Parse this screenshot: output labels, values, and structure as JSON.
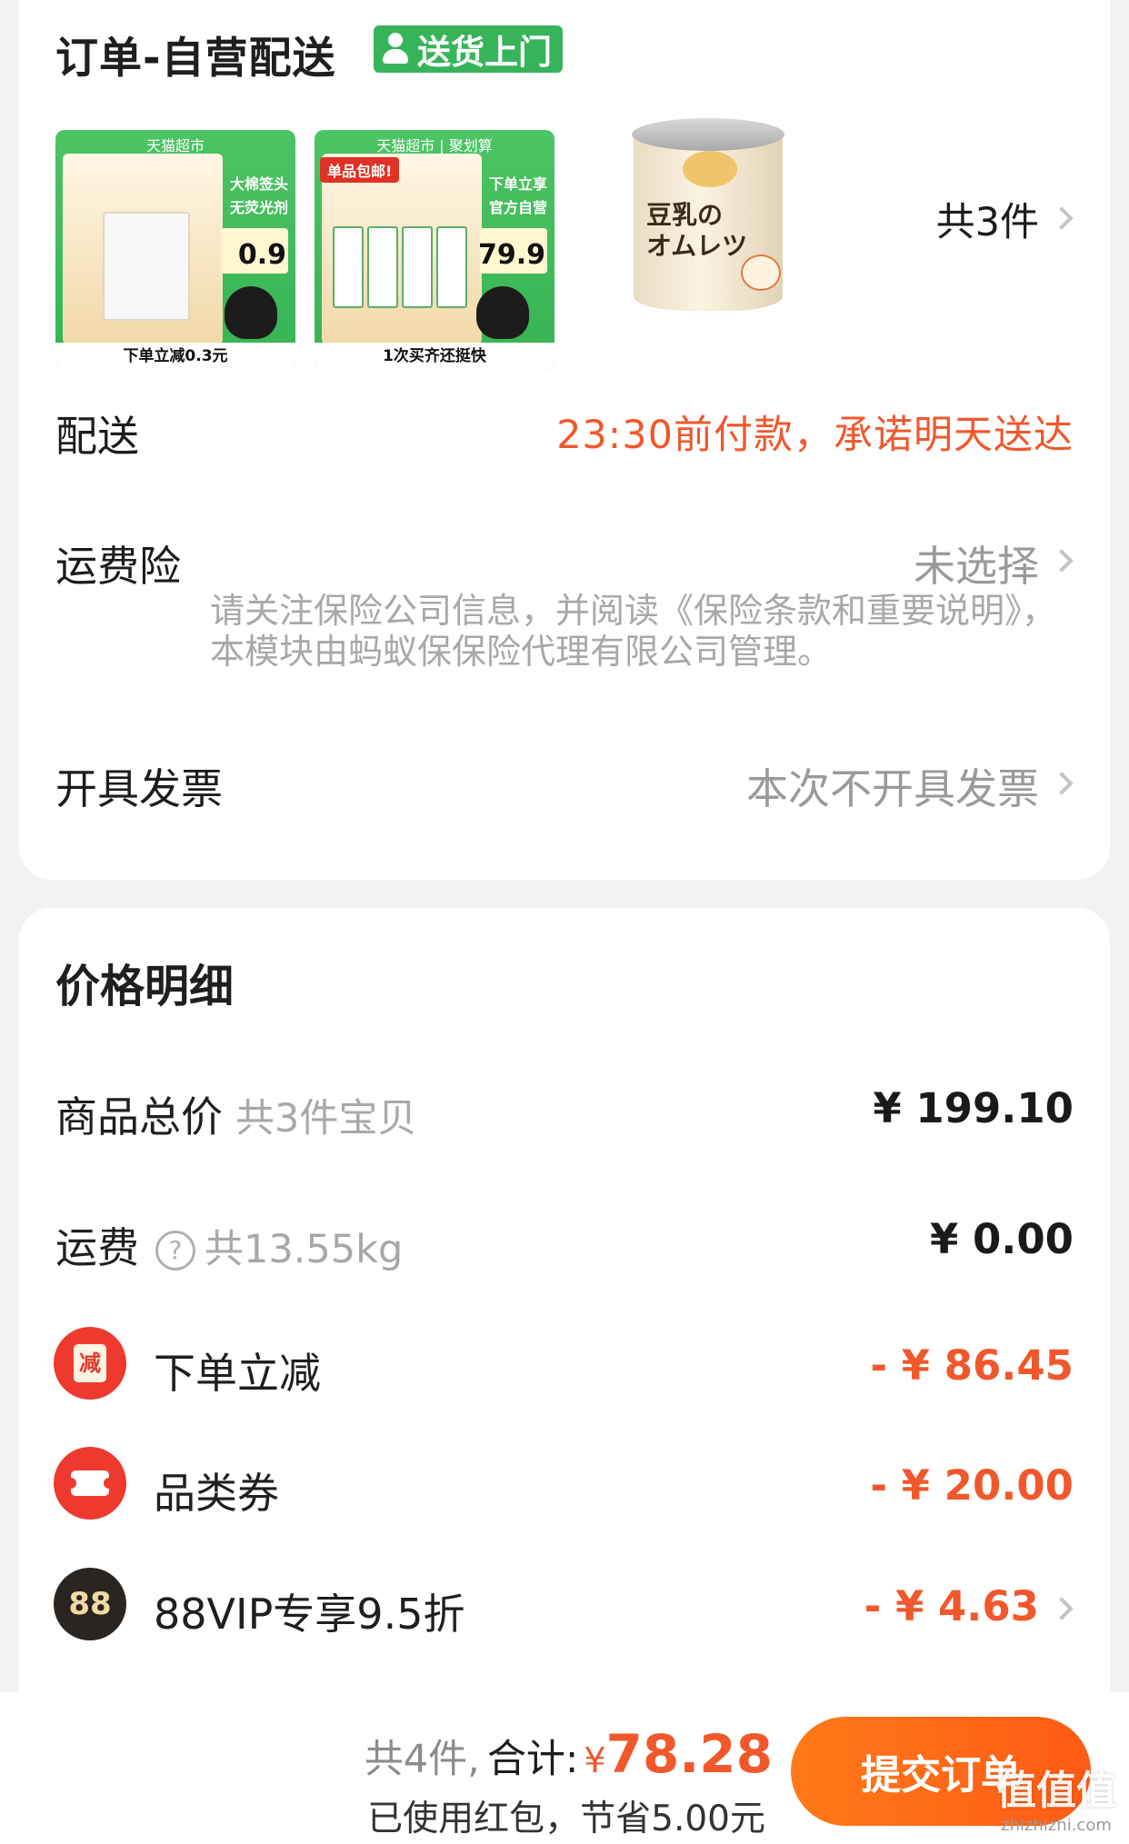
{
  "order": {
    "title": "订单-自营配送",
    "badge": "送货上门",
    "items": [
      {
        "top_tag": "天猫超市",
        "side_top": "大棉签头",
        "side_sub": "无荧光剂",
        "price": "0.9",
        "bottom": "下单立减0.3元"
      },
      {
        "top_tag": "天猫超市 | 聚划算",
        "red_tag": "单品包邮!",
        "side_top": "下单立享",
        "side_sub": "官方自营",
        "price": "79.9",
        "bottom": "1次买齐还挺快"
      },
      {
        "label": "豆乳の\nオムレツ"
      }
    ],
    "count": "共3件",
    "delivery_label": "配送",
    "delivery_promise": "23:30前付款，承诺明天送达",
    "insurance_label": "运费险",
    "insurance_value": "未选择",
    "insurance_note": "请关注保险公司信息，并阅读《保险条款和重要说明》，本模块由蚂蚁保保险代理有限公司管理。",
    "invoice_label": "开具发票",
    "invoice_value": "本次不开具发票"
  },
  "price": {
    "title": "价格明细",
    "goods_label": "商品总价",
    "goods_sub": "共3件宝贝",
    "goods_value": "¥ 199.10",
    "freight_label": "运费",
    "freight_sub": "共13.55kg",
    "freight_value": "¥ 0.00",
    "reduce_icon": "减",
    "reduce_label": "下单立减",
    "reduce_value": "- ¥ 86.45",
    "coupon_label": "品类券",
    "coupon_value": "- ¥ 20.00",
    "vip_icon": "88",
    "vip_label": "88VIP专享9.5折",
    "vip_value": "- ¥ 4.63"
  },
  "bottom": {
    "count": "共4件,",
    "total_label": "合计:",
    "currency": "¥",
    "total": "78.28",
    "saved": "已使用红包，节省5.00元",
    "submit": "提交订单"
  },
  "watermark": {
    "text": "值值值",
    "url": "zhizhizhi.com"
  },
  "colors": {
    "accent": "#f0582b",
    "green_badge": "#37b45a",
    "button": "#ff6a16"
  },
  "icons": [
    "person-icon",
    "chevron-right-icon",
    "question-icon",
    "reduce-icon",
    "coupon-icon",
    "vip-88-icon"
  ]
}
